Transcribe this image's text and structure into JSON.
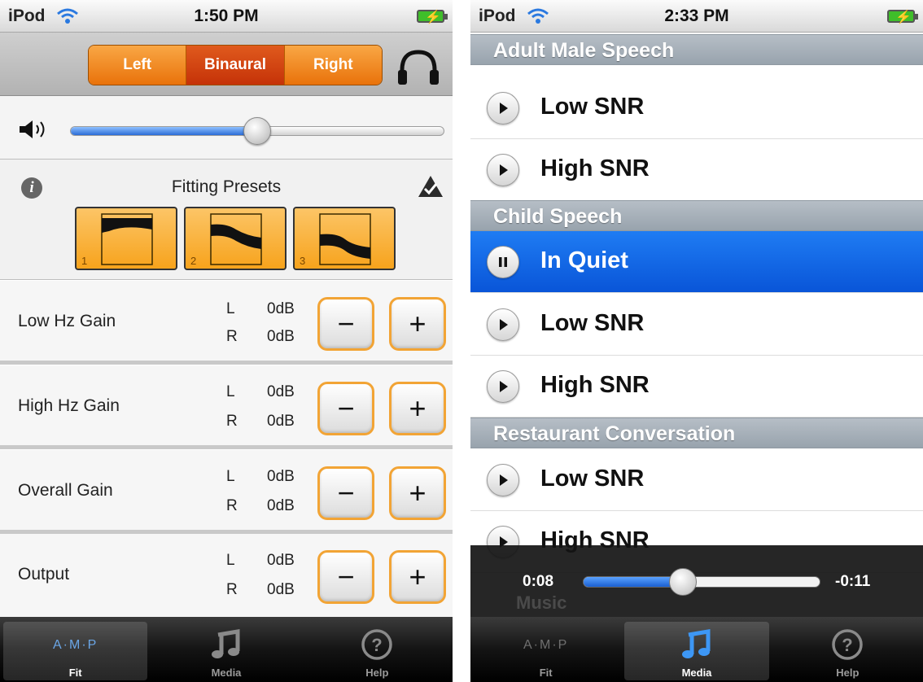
{
  "left_screen": {
    "status": {
      "carrier": "iPod",
      "time": "1:50 PM"
    },
    "segments": [
      "Left",
      "Binaural",
      "Right"
    ],
    "active_segment": "Binaural",
    "volume_level": 0.5,
    "presets": {
      "title": "Fitting Presets",
      "items": [
        "1",
        "2",
        "3"
      ]
    },
    "gains": [
      {
        "label": "Low Hz Gain",
        "l": "L",
        "r": "R",
        "l_val": "0dB",
        "r_val": "0dB"
      },
      {
        "label": "High Hz Gain",
        "l": "L",
        "r": "R",
        "l_val": "0dB",
        "r_val": "0dB"
      },
      {
        "label": "Overall Gain",
        "l": "L",
        "r": "R",
        "l_val": "0dB",
        "r_val": "0dB"
      },
      {
        "label": "Output",
        "l": "L",
        "r": "R",
        "l_val": "0dB",
        "r_val": "0dB"
      }
    ],
    "tabs": {
      "logo": "A·M·P",
      "fit": "Fit",
      "media": "Media",
      "help": "Help",
      "selected": "Fit"
    }
  },
  "right_screen": {
    "status": {
      "carrier": "iPod",
      "time": "2:33 PM"
    },
    "sections": [
      {
        "header": "Adult Male Speech",
        "items": [
          "Low SNR",
          "High SNR"
        ]
      },
      {
        "header": "Child Speech",
        "items": [
          "In Quiet",
          "Low SNR",
          "High SNR"
        ]
      },
      {
        "header": "Restaurant Conversation",
        "items": [
          "Low SNR",
          "High SNR"
        ]
      }
    ],
    "selected_item": "In Quiet",
    "partial_next_header": "Music",
    "player": {
      "elapsed": "0:08",
      "remaining": "-0:11",
      "progress": 0.42
    },
    "tabs": {
      "logo": "A·M·P",
      "fit": "Fit",
      "media": "Media",
      "help": "Help",
      "selected": "Media"
    }
  },
  "colors": {
    "accent_orange": "#f29a2e",
    "selection_blue": "#1a6fe8",
    "slider_blue": "#2a6cd6"
  },
  "icons": [
    "wifi-icon",
    "battery-icon",
    "headphones-icon",
    "speaker-icon",
    "info-icon",
    "check-icon",
    "play-icon",
    "pause-icon",
    "music-note-icon",
    "help-icon"
  ]
}
